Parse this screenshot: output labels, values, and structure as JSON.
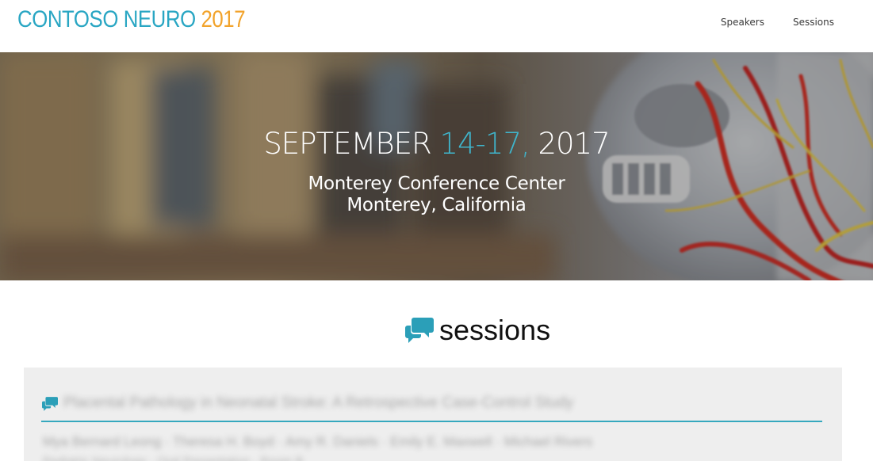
{
  "brand": {
    "name": "CONTOSO NEURO ",
    "year": "2017",
    "colors": {
      "primary": "#29a6c3",
      "accent": "#f2a32b"
    }
  },
  "nav": {
    "items": [
      {
        "label": "Speakers"
      },
      {
        "label": "Sessions"
      }
    ]
  },
  "hero": {
    "date_month": "SEPTEMBER ",
    "date_range": "14-17,",
    "date_year": " 2017",
    "venue_line1": "Monterey Conference Center",
    "venue_line2": "Monterey, California",
    "highlight_color": "#3fb5cc"
  },
  "sessions": {
    "heading": "sessions",
    "icon": "chat-bubbles-icon",
    "items": [
      {
        "title": "Placental Pathology in Neonatal Stroke: A Retrospective Case-Control Study",
        "authors": "Mya Bernard Leong · Theresa H. Boyd · Amy R. Daniels · Emily E. Maxwell · Michael Rivers",
        "meta": "Pediatric Neurology · Oral Presentation · Room B"
      }
    ]
  }
}
